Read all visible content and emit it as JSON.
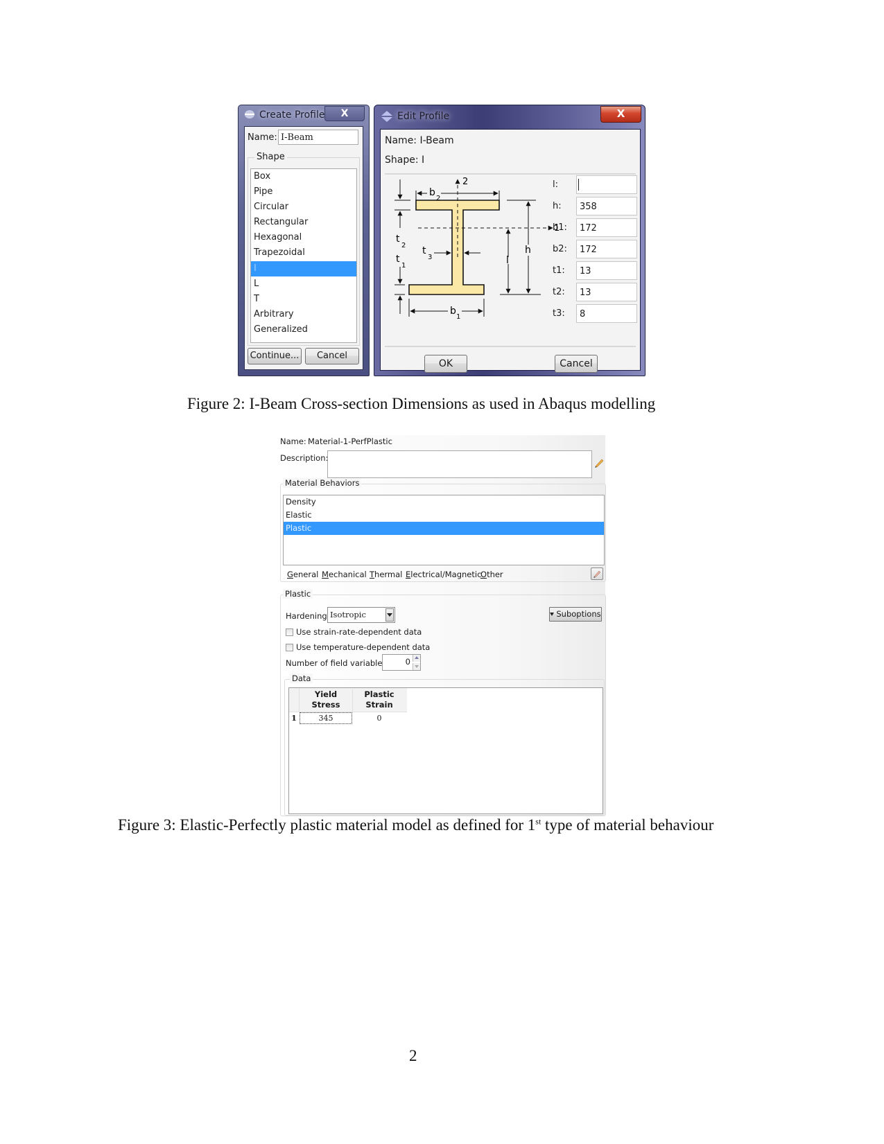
{
  "figure2": {
    "caption": "Figure 2: I-Beam Cross-section Dimensions as used in Abaqus modelling",
    "create_profile": {
      "title": "Create Profile",
      "close_label": "X",
      "name_label": "Name:",
      "name_value": "I-Beam",
      "shape_legend": "Shape",
      "shapes": [
        "Box",
        "Pipe",
        "Circular",
        "Rectangular",
        "Hexagonal",
        "Trapezoidal",
        "I",
        "L",
        "T",
        "Arbitrary",
        "Generalized"
      ],
      "selected_shape": "I",
      "continue_label": "Continue...",
      "cancel_label": "Cancel"
    },
    "edit_profile": {
      "title": "Edit Profile",
      "close_label": "X",
      "name_line": "Name:  I-Beam",
      "shape_line": "Shape:  I",
      "fields": [
        {
          "label": "l:",
          "value": ""
        },
        {
          "label": "h:",
          "value": "358"
        },
        {
          "label": "b1:",
          "value": "172"
        },
        {
          "label": "b2:",
          "value": "172"
        },
        {
          "label": "t1:",
          "value": "13"
        },
        {
          "label": "t2:",
          "value": "13"
        },
        {
          "label": "t3:",
          "value": "8"
        }
      ],
      "diagram_labels": {
        "axis2": "2",
        "axis1": "1",
        "b2": "b",
        "b2_sub": "2",
        "b1": "b",
        "b1_sub": "1",
        "t1": "t",
        "t1_sub": "1",
        "t2": "t",
        "t2_sub": "2",
        "t3": "t",
        "t3_sub": "3",
        "h": "h",
        "l": "l"
      },
      "ok_label": "OK",
      "cancel_label": "Cancel"
    }
  },
  "figure3": {
    "caption_prefix": "Figure 3: Elastic-Perfectly plastic material model as defined for 1",
    "caption_sup": "st",
    "caption_suffix": " type of material behaviour",
    "material": {
      "name_label": "Name:",
      "name_value": "Material-1-PerfPlastic",
      "description_label": "Description:",
      "description_value": "",
      "behaviors_legend": "Material Behaviors",
      "behaviors": [
        "Density",
        "Elastic",
        "Plastic"
      ],
      "selected_behavior": "Plastic",
      "menu": [
        {
          "key": "G",
          "rest": "eneral"
        },
        {
          "key": "M",
          "rest": "echanical"
        },
        {
          "key": "T",
          "rest": "hermal"
        },
        {
          "key": "E",
          "rest": "lectrical/Magnetic"
        },
        {
          "key": "O",
          "rest": "ther"
        }
      ],
      "plastic_legend": "Plastic",
      "hardening_label": "Hardening:",
      "hardening_value": "Isotropic",
      "suboptions_label": "Suboptions",
      "strain_rate_label": "Use strain-rate-dependent data",
      "strain_rate_checked": false,
      "temperature_label": "Use temperature-dependent data",
      "temperature_checked": false,
      "field_vars_label": "Number of field variables:",
      "field_vars_value": "0",
      "data_legend": "Data",
      "table": {
        "headers": [
          [
            "Yield",
            "Stress"
          ],
          [
            "Plastic",
            "Strain"
          ]
        ],
        "rows": [
          {
            "index": "1",
            "cells": [
              "345",
              "0"
            ]
          }
        ]
      }
    }
  },
  "page_number": "2"
}
